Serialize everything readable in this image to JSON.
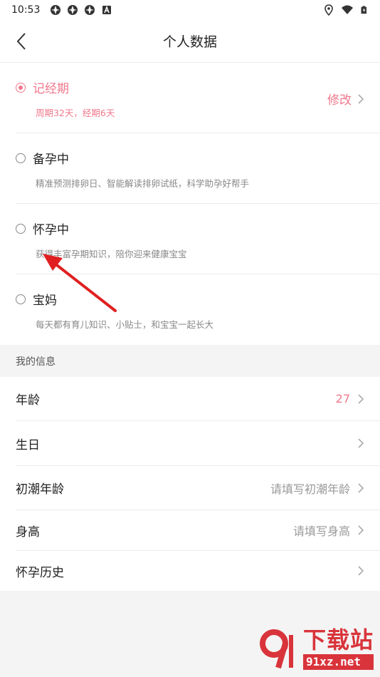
{
  "status_bar": {
    "time": "10:53"
  },
  "header": {
    "title": "个人数据"
  },
  "status_options": [
    {
      "title": "记经期",
      "desc": "周期32天，经期6天",
      "selected": true,
      "action": "修改"
    },
    {
      "title": "备孕中",
      "desc": "精准预测排卵日、智能解读排卵试纸，科学助孕好帮手",
      "selected": false
    },
    {
      "title": "怀孕中",
      "desc": "获得丰富孕期知识，陪你迎来健康宝宝",
      "selected": false
    },
    {
      "title": "宝妈",
      "desc": "每天都有育儿知识、小贴士，和宝宝一起长大",
      "selected": false
    }
  ],
  "my_info": {
    "header": "我的信息",
    "rows": [
      {
        "label": "年龄",
        "value": "27"
      },
      {
        "label": "生日",
        "value": ""
      },
      {
        "label": "初潮年龄",
        "value": "请填写初潮年龄"
      },
      {
        "label": "身高",
        "value": "请填写身高"
      },
      {
        "label": "怀孕历史",
        "value": ""
      }
    ]
  },
  "watermark": {
    "brand": "下载站",
    "domain": "91xz.net"
  },
  "colors": {
    "accent": "#f0788c",
    "watermark_red": "#d9343b"
  }
}
